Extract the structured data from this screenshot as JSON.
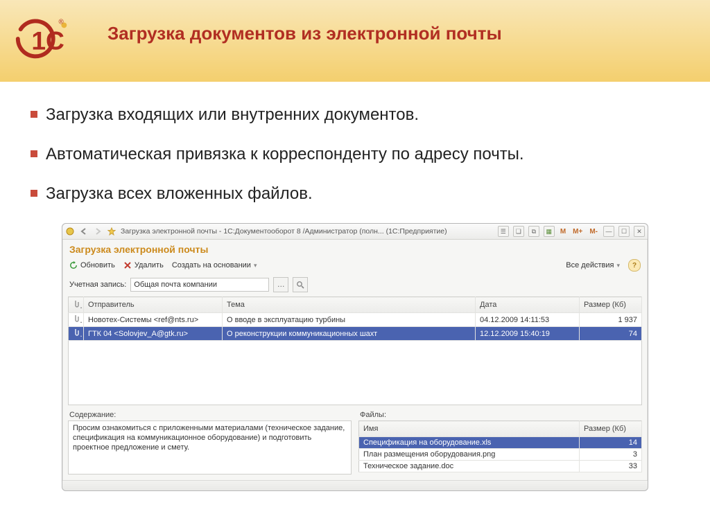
{
  "slide": {
    "title": "Загрузка документов из электронной почты",
    "bullets": [
      "Загрузка входящих или внутренних документов.",
      "Автоматическая привязка к корреспонденту по адресу почты.",
      "Загрузка всех вложенных файлов."
    ]
  },
  "window": {
    "title": "Загрузка электронной почты - 1С:Документооборот 8 /Администратор (полн... (1С:Предприятие)",
    "form_title": "Загрузка электронной почты",
    "toolbar": {
      "refresh": "Обновить",
      "delete": "Удалить",
      "create_based_on": "Создать на основании",
      "all_actions": "Все действия"
    },
    "account": {
      "label": "Учетная запись:",
      "value": "Общая почта компании"
    },
    "mail": {
      "cols": {
        "sender": "Отправитель",
        "subject": "Тема",
        "date": "Дата",
        "size": "Размер (Кб)"
      },
      "rows": [
        {
          "sender": "Новотех-Системы <ref@nts.ru>",
          "subject": "О вводе в эксплуатацию турбины",
          "date": "04.12.2009 14:11:53",
          "size": "1 937",
          "selected": false
        },
        {
          "sender": "ГТК 04 <Solovjev_A@gtk.ru>",
          "subject": "О реконструкции коммуникационных шахт",
          "date": "12.12.2009 15:40:19",
          "size": "74",
          "selected": true
        }
      ]
    },
    "content": {
      "label": "Содержание:",
      "text": "Просим ознакомиться с приложенными материалами (техническое задание, спецификация на коммуникационное оборудование) и подготовить проектное предложение и смету."
    },
    "files": {
      "label": "Файлы:",
      "cols": {
        "name": "Имя",
        "size": "Размер (Кб)"
      },
      "rows": [
        {
          "name": "Спецификация на оборудование.xls",
          "size": "14",
          "selected": true
        },
        {
          "name": "План размещения оборудования.png",
          "size": "3",
          "selected": false
        },
        {
          "name": "Техническое задание.doc",
          "size": "33",
          "selected": false
        }
      ]
    },
    "title_buttons": {
      "m": "M",
      "mplus": "M+",
      "mminus": "M-"
    }
  }
}
